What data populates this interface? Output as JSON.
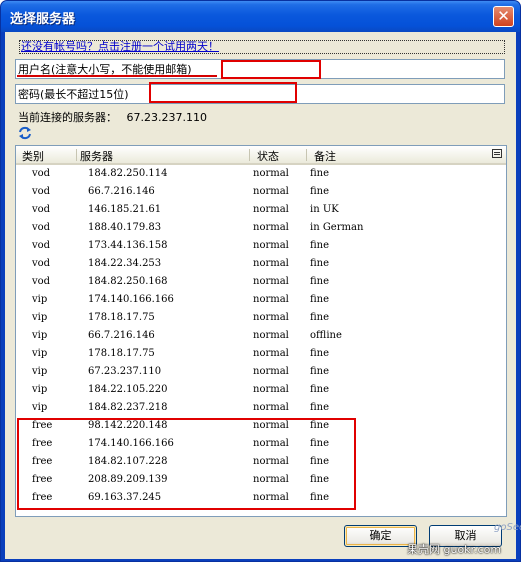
{
  "window": {
    "title": "选择服务器",
    "close_symbol": "✕"
  },
  "register_link": "还没有帐号吗？点击注册一个试用两天！",
  "username": {
    "label": "用户名(注意大小写，不能使用邮箱)",
    "value": ""
  },
  "password": {
    "label": "密码(最长不超过15位)",
    "value": ""
  },
  "current_server": {
    "label": "当前连接的服务器：",
    "value": "67.23.237.110"
  },
  "refresh_icon": "refresh-icon",
  "table": {
    "headers": {
      "type": "类别",
      "server": "服务器",
      "status": "状态",
      "note": "备注"
    },
    "rows": [
      {
        "type": "vod",
        "server": "184.82.250.114",
        "status": "normal",
        "note": "fine"
      },
      {
        "type": "vod",
        "server": "66.7.216.146",
        "status": "normal",
        "note": "fine"
      },
      {
        "type": "vod",
        "server": "146.185.21.61",
        "status": "normal",
        "note": "in UK"
      },
      {
        "type": "vod",
        "server": "188.40.179.83",
        "status": "normal",
        "note": "in German"
      },
      {
        "type": "vod",
        "server": "173.44.136.158",
        "status": "normal",
        "note": "fine"
      },
      {
        "type": "vod",
        "server": "184.22.34.253",
        "status": "normal",
        "note": "fine"
      },
      {
        "type": "vod",
        "server": "184.82.250.168",
        "status": "normal",
        "note": "fine"
      },
      {
        "type": "vip",
        "server": "174.140.166.166",
        "status": "normal",
        "note": "fine"
      },
      {
        "type": "vip",
        "server": "178.18.17.75",
        "status": "normal",
        "note": "fine"
      },
      {
        "type": "vip",
        "server": "66.7.216.146",
        "status": "normal",
        "note": "offline"
      },
      {
        "type": "vip",
        "server": "178.18.17.75",
        "status": "normal",
        "note": "fine"
      },
      {
        "type": "vip",
        "server": "67.23.237.110",
        "status": "normal",
        "note": "fine"
      },
      {
        "type": "vip",
        "server": "184.22.105.220",
        "status": "normal",
        "note": "fine"
      },
      {
        "type": "vip",
        "server": "184.82.237.218",
        "status": "normal",
        "note": "fine"
      },
      {
        "type": "free",
        "server": "98.142.220.148",
        "status": "normal",
        "note": "fine"
      },
      {
        "type": "free",
        "server": "174.140.166.166",
        "status": "normal",
        "note": "fine"
      },
      {
        "type": "free",
        "server": "184.82.107.228",
        "status": "normal",
        "note": "fine"
      },
      {
        "type": "free",
        "server": "208.89.209.139",
        "status": "normal",
        "note": "fine"
      },
      {
        "type": "free",
        "server": "69.163.37.245",
        "status": "normal",
        "note": "fine"
      }
    ]
  },
  "buttons": {
    "ok": "确定",
    "cancel": "取消"
  },
  "watermarks": {
    "gosees": "goSees",
    "guokr": "果壳网 guokr.com"
  },
  "colors": {
    "highlight_red": "#e00000",
    "title_blue": "#0a58dd"
  }
}
